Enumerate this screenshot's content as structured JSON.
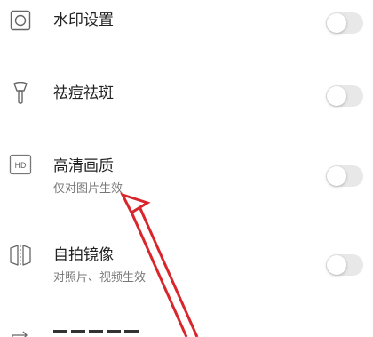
{
  "settings": {
    "items": [
      {
        "icon": "square-circle-icon",
        "title": "水印设置",
        "subtitle": "",
        "enabled": false
      },
      {
        "icon": "makeup-brush-icon",
        "title": "祛痘祛斑",
        "subtitle": "",
        "enabled": false
      },
      {
        "icon": "hd-icon",
        "title": "高清画质",
        "subtitle": "仅对图片生效",
        "enabled": false
      },
      {
        "icon": "mirror-icon",
        "title": "自拍镜像",
        "subtitle": "对照片、视频生效",
        "enabled": false
      }
    ]
  },
  "icons": {
    "hd_icon_text": "HD"
  },
  "colors": {
    "toggle_off": "#e8e8e8",
    "annotation_arrow": "#d9262c",
    "title_text": "#222222",
    "subtitle_text": "#777777"
  }
}
